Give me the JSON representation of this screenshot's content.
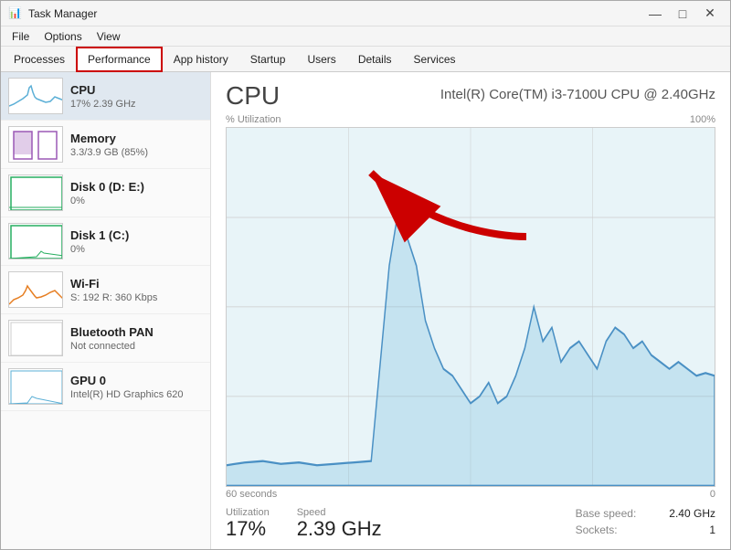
{
  "window": {
    "title": "Task Manager",
    "icon": "⊞"
  },
  "menu": {
    "items": [
      "File",
      "Options",
      "View"
    ]
  },
  "tabs": {
    "items": [
      "Processes",
      "Performance",
      "App history",
      "Startup",
      "Users",
      "Details",
      "Services"
    ],
    "active": "Performance"
  },
  "sidebar": {
    "items": [
      {
        "id": "cpu",
        "name": "CPU",
        "detail": "17%  2.39 GHz",
        "type": "cpu",
        "active": true
      },
      {
        "id": "memory",
        "name": "Memory",
        "detail": "3.3/3.9 GB (85%)",
        "type": "mem"
      },
      {
        "id": "disk0",
        "name": "Disk 0 (D: E:)",
        "detail": "0%",
        "type": "disk0"
      },
      {
        "id": "disk1",
        "name": "Disk 1 (C:)",
        "detail": "0%",
        "type": "disk1"
      },
      {
        "id": "wifi",
        "name": "Wi-Fi",
        "detail": "S: 192  R: 360 Kbps",
        "type": "wifi"
      },
      {
        "id": "bluetooth",
        "name": "Bluetooth PAN",
        "detail": "Not connected",
        "type": "bt"
      },
      {
        "id": "gpu0",
        "name": "GPU 0",
        "detail": "Intel(R) HD Graphics 620",
        "type": "gpu"
      }
    ]
  },
  "main": {
    "title": "CPU",
    "cpu_name": "Intel(R) Core(TM) i3-7100U CPU @ 2.40GHz",
    "chart": {
      "y_label": "% Utilization",
      "y_max": "100%",
      "x_start": "60 seconds",
      "x_end": "0"
    },
    "stats": {
      "utilization_label": "Utilization",
      "utilization_value": "17%",
      "speed_label": "Speed",
      "speed_value": "2.39 GHz",
      "right": [
        {
          "label": "Base speed:",
          "value": "2.40 GHz"
        },
        {
          "label": "Sockets:",
          "value": "1"
        }
      ]
    }
  }
}
